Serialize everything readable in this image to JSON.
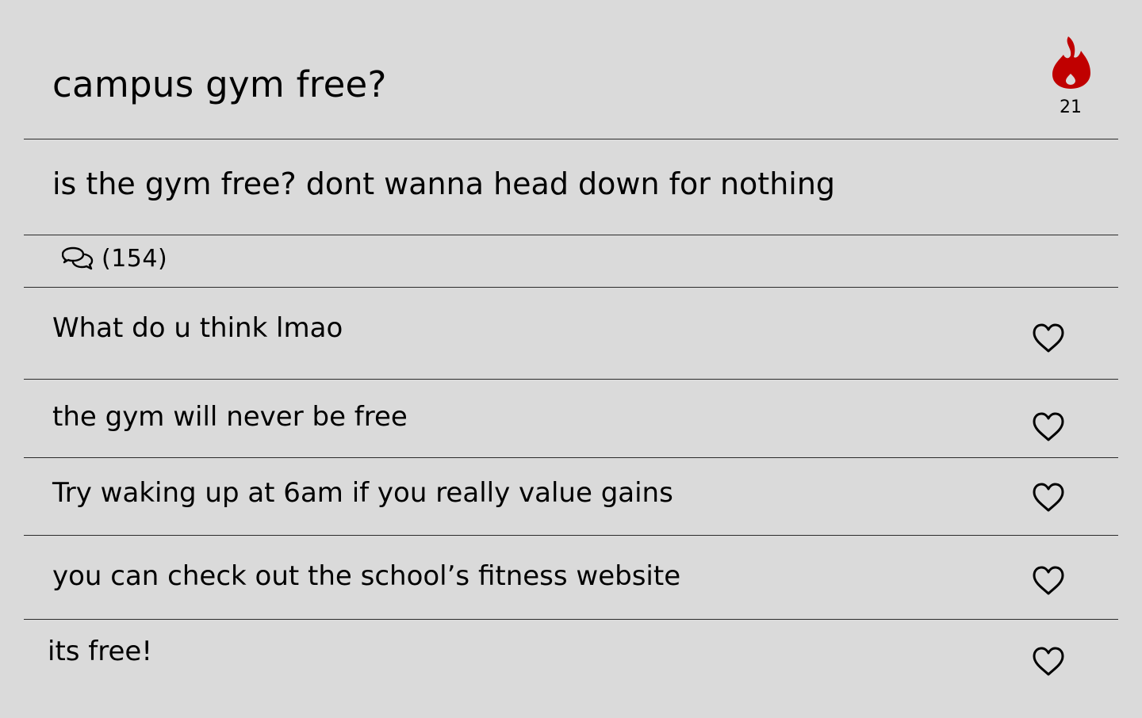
{
  "post": {
    "title": "campus gym free?",
    "body": "is the gym free? dont wanna head down for nothing",
    "heat_count": "21",
    "comment_count": "(154)"
  },
  "replies": [
    {
      "text": "What do u think lmao"
    },
    {
      "text": "the gym will never be free"
    },
    {
      "text": "Try waking up at 6am if you really value gains"
    },
    {
      "text": "you can check out the school’s fitness website"
    },
    {
      "text": "its free!"
    }
  ],
  "icons": {
    "heat": "flame-icon",
    "comments": "comments-icon",
    "like": "heart-outline-icon"
  },
  "colors": {
    "background": "#dadada",
    "flame": "#c00000",
    "text": "#000000"
  }
}
